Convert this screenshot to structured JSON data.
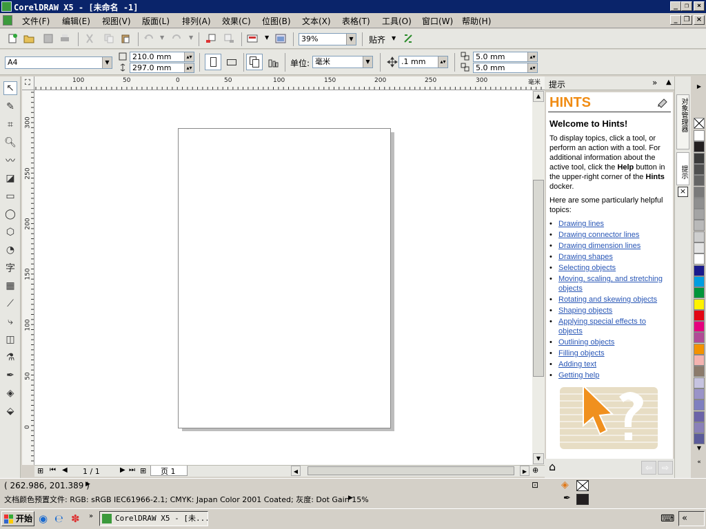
{
  "window": {
    "title": "CorelDRAW X5 - [未命名 -1]"
  },
  "menu": [
    "文件(F)",
    "编辑(E)",
    "视图(V)",
    "版面(L)",
    "排列(A)",
    "效果(C)",
    "位图(B)",
    "文本(X)",
    "表格(T)",
    "工具(O)",
    "窗口(W)",
    "帮助(H)"
  ],
  "toolbar": {
    "zoom": "39%",
    "snap_label": "贴齐"
  },
  "propbar": {
    "paper": "A4",
    "width": "210.0 mm",
    "height": "297.0 mm",
    "units_label": "单位:",
    "units_value": "毫米",
    "nudge": ".1 mm",
    "dup_x": "5.0 mm",
    "dup_y": "5.0 mm"
  },
  "ruler_top": [
    "100",
    "50",
    "0",
    "50",
    "100",
    "150",
    "200",
    "250",
    "300",
    "毫米"
  ],
  "ruler_left": [
    "300",
    "250",
    "200",
    "150",
    "100",
    "50",
    "0"
  ],
  "pages": {
    "counter": "1 / 1",
    "tab": "页 1"
  },
  "docker": {
    "title": "提示",
    "hints_title": "HINTS",
    "welcome": "Welcome to Hints!",
    "intro_parts": [
      "To display topics, click a tool, or perform an action with a tool. For additional information about the active tool, click the ",
      "Help",
      " button in the upper-right corner of the ",
      "Hints",
      " docker."
    ],
    "helpful": "Here are some particularly helpful topics:",
    "topics": [
      "Drawing lines",
      "Drawing connector lines",
      "Drawing dimension lines",
      "Drawing shapes",
      "Selecting objects",
      "Moving, scaling, and stretching objects",
      "Rotating and skewing objects",
      "Shaping objects",
      "Applying special effects to objects",
      "Outlining objects",
      "Filling objects",
      "Adding text",
      "Getting help"
    ],
    "side_tabs": [
      "对象管理器",
      "提示"
    ]
  },
  "palette": [
    "#ffffff",
    "#231f20",
    "#3b3b3b",
    "#505050",
    "#656565",
    "#7a7a7a",
    "#8f8f8f",
    "#a4a4a4",
    "#b9b9b9",
    "#cecece",
    "#e3e3e3",
    "#ffffff",
    "#1a1a8c",
    "#009ee0",
    "#00953a",
    "#fff200",
    "#e30613",
    "#e6007e",
    "#b14b96",
    "#f39200",
    "#f4b3b0",
    "#8b7a6b",
    "#c6c3e0",
    "#9a93c8",
    "#7f7fbf",
    "#6c63a8",
    "#8a80b8",
    "#5b5b9a"
  ],
  "status": {
    "coords": "( 262.986, 201.389 )",
    "profile": "文档颜色预置文件: RGB: sRGB IEC61966-2.1; CMYK: Japan Color 2001 Coated; 灰度: Dot Gain 15%"
  },
  "taskbar": {
    "start": "开始",
    "task": "CorelDRAW X5 - [未..."
  }
}
